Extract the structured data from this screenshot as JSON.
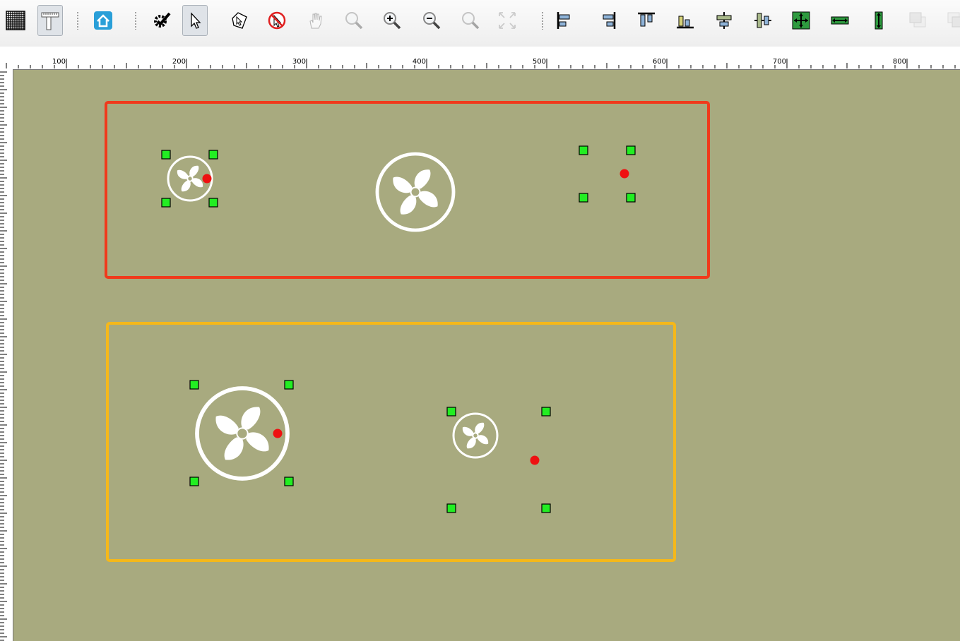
{
  "toolbar": {
    "groups": [
      [
        "grid-icon",
        "ruler-icon"
      ],
      [
        "home-icon"
      ],
      [
        "settings-check-icon",
        "select-pointer-icon",
        "edit-pointer-icon",
        "no-pointer-icon",
        "pan-hand-icon",
        "zoom-icon",
        "zoom-in-icon",
        "zoom-out-icon",
        "zoom-window-icon",
        "fit-screen-icon"
      ],
      [
        "align-left-icon",
        "align-right-icon",
        "align-top-icon",
        "align-bottom-icon",
        "align-center-horizontal-icon",
        "align-center-vertical-icon",
        "same-size-icon",
        "same-width-icon",
        "same-height-icon",
        "bring-front-icon",
        "send-back-icon"
      ]
    ],
    "pressed": [
      "ruler-icon",
      "select-pointer-icon"
    ],
    "disabled": [
      "pan-hand-icon",
      "zoom-icon",
      "zoom-window-icon",
      "fit-screen-icon",
      "bring-front-icon",
      "send-back-icon"
    ]
  },
  "ruler": {
    "labels": [
      "100",
      "200",
      "300",
      "400",
      "500",
      "600",
      "700",
      "800"
    ]
  },
  "canvas": {
    "background": "#a8aa7f",
    "groups": [
      {
        "name": "group-red",
        "color": "#f03a1c"
      },
      {
        "name": "group-yellow",
        "color": "#f5b81a"
      }
    ],
    "handle_color": "#22ee22",
    "pivot_color": "#ee1111",
    "fan_color": "#ffffff"
  }
}
